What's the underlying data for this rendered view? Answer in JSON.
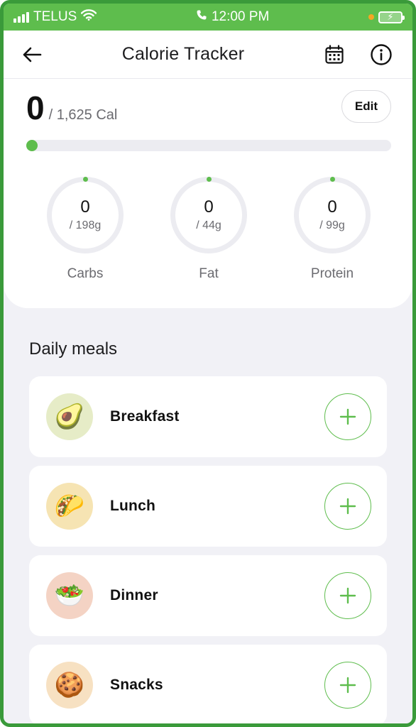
{
  "status_bar": {
    "carrier": "TELUS",
    "time": "12:00 PM",
    "signal_icon": "signal-bars-icon",
    "wifi_icon": "wifi-icon",
    "call_icon": "phone-icon",
    "battery_icon": "battery-charging-icon"
  },
  "nav": {
    "title": "Calorie Tracker",
    "back_icon": "arrow-left-icon",
    "calendar_icon": "calendar-icon",
    "info_icon": "info-icon"
  },
  "summary": {
    "calories_consumed": "0",
    "calories_goal": "/ 1,625 Cal",
    "edit_label": "Edit",
    "progress_fraction": 0
  },
  "macros": [
    {
      "value": "0",
      "goal": "/ 198g",
      "label": "Carbs",
      "fraction": 0
    },
    {
      "value": "0",
      "goal": "/ 44g",
      "label": "Fat",
      "fraction": 0
    },
    {
      "value": "0",
      "goal": "/ 99g",
      "label": "Protein",
      "fraction": 0
    }
  ],
  "meals_section": {
    "title": "Daily meals",
    "items": [
      {
        "name": "Breakfast",
        "icon": "avocado-icon",
        "emoji": "🥑",
        "bg": "#e6ecc7"
      },
      {
        "name": "Lunch",
        "icon": "taco-icon",
        "emoji": "🌮",
        "bg": "#f6e4b3"
      },
      {
        "name": "Dinner",
        "icon": "salad-bowl-icon",
        "emoji": "🥗",
        "bg": "#f4d3c4"
      },
      {
        "name": "Snacks",
        "icon": "cookie-icon",
        "emoji": "🍪",
        "bg": "#f7e1c2"
      }
    ],
    "add_icon": "plus-icon"
  },
  "colors": {
    "accent": "#5ebd4d",
    "frame": "#3a9a3a",
    "background": "#f1f1f6"
  }
}
